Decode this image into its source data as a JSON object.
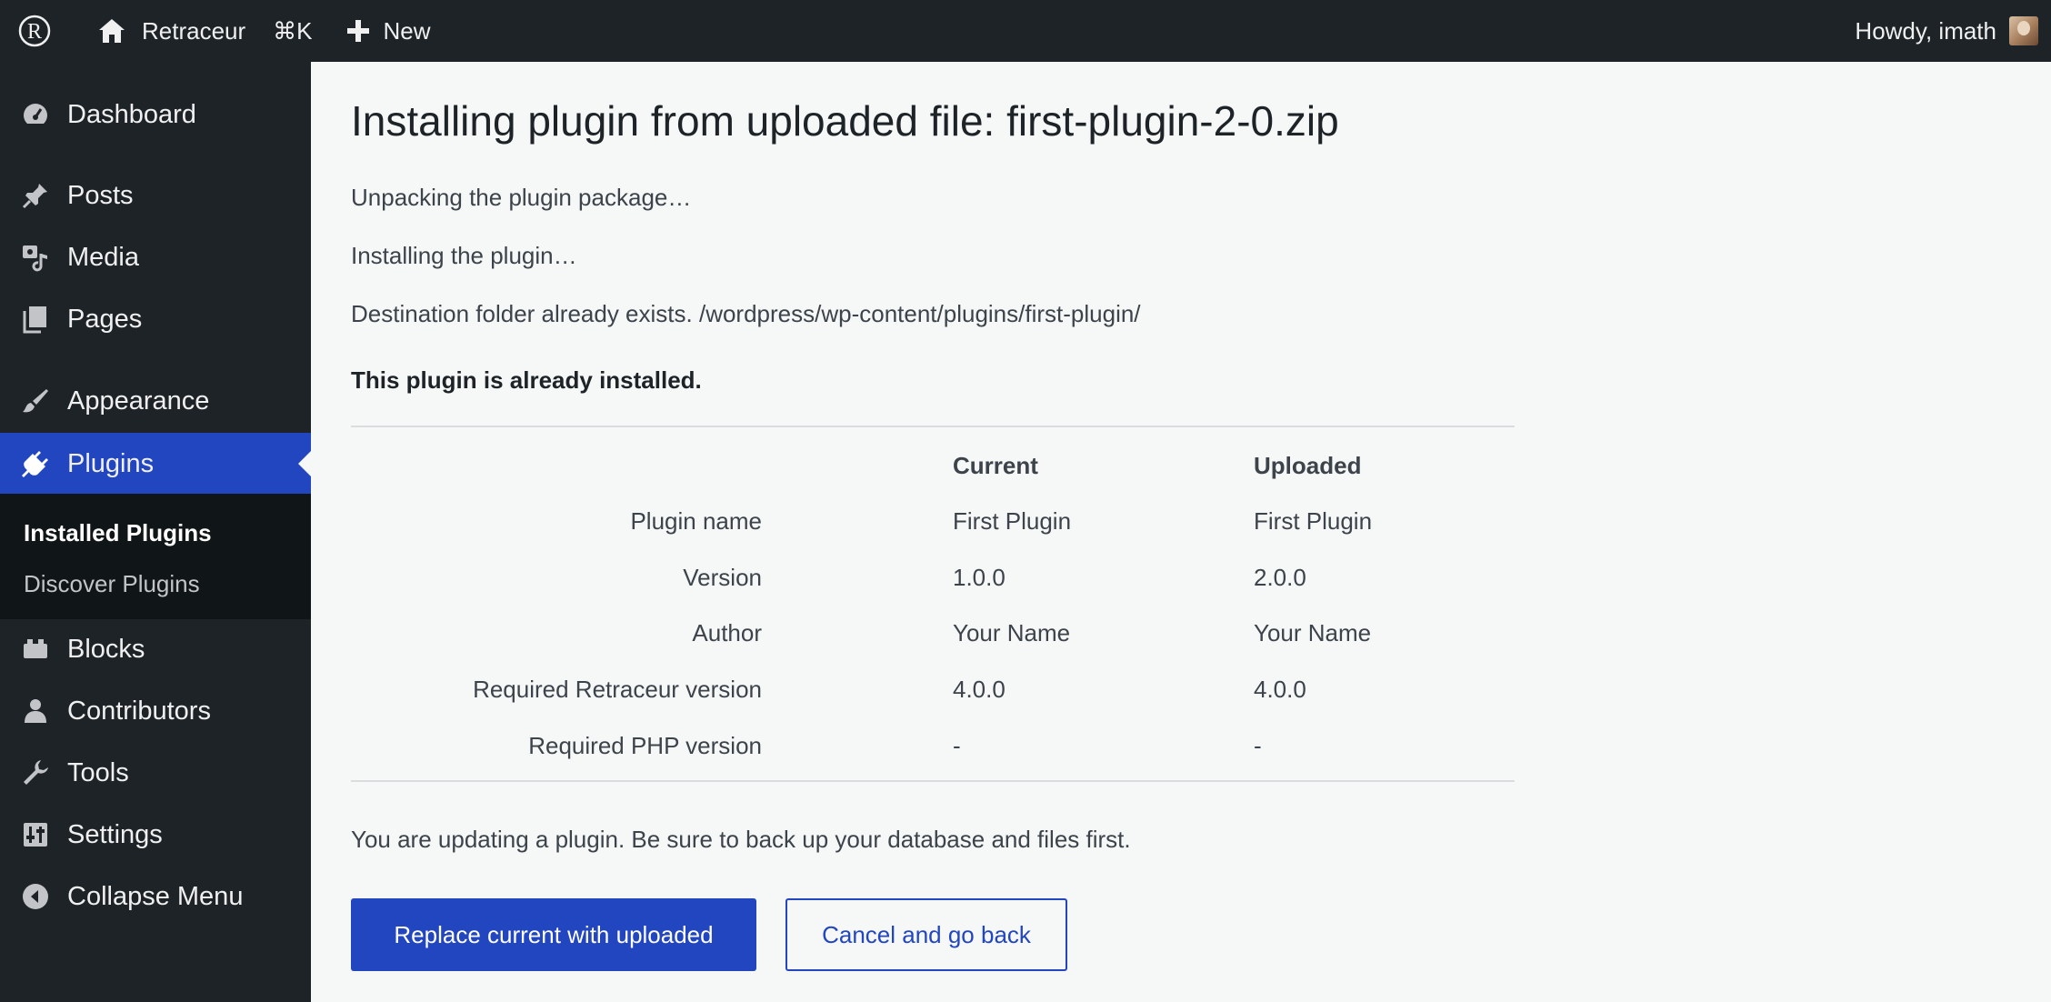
{
  "adminbar": {
    "site_name": "Retraceur",
    "command_shortcut": "⌘K",
    "new_label": "New",
    "greeting": "Howdy, imath"
  },
  "sidebar": {
    "items": [
      {
        "label": "Dashboard",
        "icon": "dashboard-icon"
      },
      {
        "label": "Posts",
        "icon": "pin-icon"
      },
      {
        "label": "Media",
        "icon": "media-icon"
      },
      {
        "label": "Pages",
        "icon": "pages-icon"
      },
      {
        "label": "Appearance",
        "icon": "brush-icon"
      },
      {
        "label": "Plugins",
        "icon": "plugin-icon"
      },
      {
        "label": "Blocks",
        "icon": "blocks-icon"
      },
      {
        "label": "Contributors",
        "icon": "user-icon"
      },
      {
        "label": "Tools",
        "icon": "wrench-icon"
      },
      {
        "label": "Settings",
        "icon": "sliders-icon"
      },
      {
        "label": "Collapse Menu",
        "icon": "collapse-icon"
      }
    ],
    "active": "Plugins",
    "submenu": [
      "Installed Plugins",
      "Discover Plugins"
    ],
    "submenu_current": "Installed Plugins"
  },
  "main": {
    "title": "Installing plugin from uploaded file: first-plugin-2-0.zip",
    "messages": [
      "Unpacking the plugin package…",
      "Installing the plugin…",
      "Destination folder already exists. /wordpress/wp-content/plugins/first-plugin/"
    ],
    "notice": "This plugin is already installed.",
    "table": {
      "headers": [
        "Current",
        "Uploaded"
      ],
      "rows": [
        {
          "label": "Plugin name",
          "current": "First Plugin",
          "uploaded": "First Plugin"
        },
        {
          "label": "Version",
          "current": "1.0.0",
          "uploaded": "2.0.0"
        },
        {
          "label": "Author",
          "current": "Your Name",
          "uploaded": "Your Name"
        },
        {
          "label": "Required Retraceur version",
          "current": "4.0.0",
          "uploaded": "4.0.0"
        },
        {
          "label": "Required PHP version",
          "current": "-",
          "uploaded": "-"
        }
      ]
    },
    "warning": "You are updating a plugin. Be sure to back up your database and files first.",
    "buttons": {
      "replace": "Replace current with uploaded",
      "cancel": "Cancel and go back"
    }
  },
  "colors": {
    "admin_bg": "#1d2327",
    "accent": "#2245c0",
    "content_bg": "#f6f7f7"
  }
}
